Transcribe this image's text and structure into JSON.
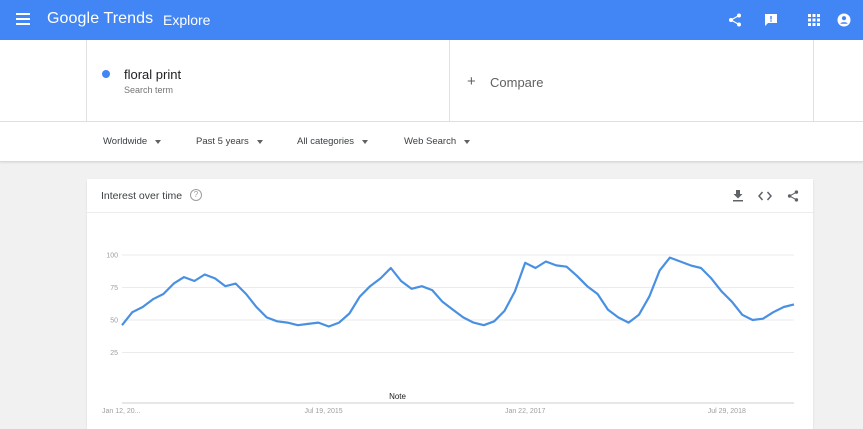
{
  "app": {
    "logo": "Google Trends",
    "section": "Explore"
  },
  "search": {
    "term": "floral print",
    "term_type": "Search term",
    "compare_label": "Compare",
    "term_color": "#4285f4"
  },
  "filters": {
    "region": "Worldwide",
    "time": "Past 5 years",
    "category": "All categories",
    "property": "Web Search"
  },
  "card": {
    "title": "Interest over time",
    "help": "?",
    "note": "Note"
  },
  "icons": {
    "menu": "menu-icon",
    "share": "share-icon",
    "feedback": "feedback-icon",
    "apps": "apps-icon",
    "account": "account-icon",
    "download": "download-icon",
    "embed": "embed-icon",
    "help": "help-icon"
  },
  "chart_data": {
    "type": "line",
    "series": [
      {
        "name": "floral print",
        "color": "#4285f4"
      }
    ],
    "ylim": [
      0,
      100
    ],
    "yticks": [
      "100",
      "75",
      "50",
      "25"
    ],
    "xticks": [
      "Jan 12, 20...",
      "Jul 19, 2015",
      "Jan 22, 2017",
      "Jul 29, 2018"
    ],
    "xrange": [
      "2014-01-12",
      "2019-01-06"
    ],
    "points": [
      [
        "2014-01-12",
        46
      ],
      [
        "2014-02-09",
        56
      ],
      [
        "2014-03-09",
        60
      ],
      [
        "2014-04-06",
        66
      ],
      [
        "2014-05-04",
        70
      ],
      [
        "2014-06-01",
        78
      ],
      [
        "2014-06-29",
        83
      ],
      [
        "2014-07-27",
        80
      ],
      [
        "2014-08-24",
        85
      ],
      [
        "2014-09-21",
        82
      ],
      [
        "2014-10-19",
        76
      ],
      [
        "2014-11-16",
        78
      ],
      [
        "2014-12-14",
        70
      ],
      [
        "2015-01-11",
        60
      ],
      [
        "2015-02-08",
        52
      ],
      [
        "2015-03-08",
        49
      ],
      [
        "2015-04-05",
        48
      ],
      [
        "2015-05-03",
        46
      ],
      [
        "2015-05-31",
        47
      ],
      [
        "2015-06-28",
        48
      ],
      [
        "2015-07-26",
        45
      ],
      [
        "2015-08-23",
        48
      ],
      [
        "2015-09-20",
        55
      ],
      [
        "2015-10-18",
        68
      ],
      [
        "2015-11-15",
        76
      ],
      [
        "2015-12-13",
        82
      ],
      [
        "2016-01-10",
        90
      ],
      [
        "2016-02-07",
        80
      ],
      [
        "2016-03-06",
        74
      ],
      [
        "2016-04-03",
        76
      ],
      [
        "2016-05-01",
        73
      ],
      [
        "2016-05-29",
        64
      ],
      [
        "2016-06-26",
        58
      ],
      [
        "2016-07-24",
        52
      ],
      [
        "2016-08-21",
        48
      ],
      [
        "2016-09-18",
        46
      ],
      [
        "2016-10-16",
        49
      ],
      [
        "2016-11-13",
        57
      ],
      [
        "2016-12-11",
        72
      ],
      [
        "2017-01-08",
        94
      ],
      [
        "2017-02-05",
        90
      ],
      [
        "2017-03-05",
        95
      ],
      [
        "2017-04-02",
        92
      ],
      [
        "2017-04-30",
        91
      ],
      [
        "2017-05-28",
        84
      ],
      [
        "2017-06-25",
        76
      ],
      [
        "2017-07-23",
        70
      ],
      [
        "2017-08-20",
        58
      ],
      [
        "2017-09-17",
        52
      ],
      [
        "2017-10-15",
        48
      ],
      [
        "2017-11-12",
        54
      ],
      [
        "2017-12-10",
        68
      ],
      [
        "2018-01-07",
        88
      ],
      [
        "2018-02-04",
        98
      ],
      [
        "2018-03-04",
        95
      ],
      [
        "2018-04-01",
        92
      ],
      [
        "2018-04-29",
        90
      ],
      [
        "2018-05-27",
        82
      ],
      [
        "2018-06-24",
        72
      ],
      [
        "2018-07-22",
        64
      ],
      [
        "2018-08-19",
        54
      ],
      [
        "2018-09-16",
        50
      ],
      [
        "2018-10-14",
        51
      ],
      [
        "2018-11-11",
        56
      ],
      [
        "2018-12-09",
        60
      ],
      [
        "2019-01-06",
        62
      ]
    ]
  }
}
